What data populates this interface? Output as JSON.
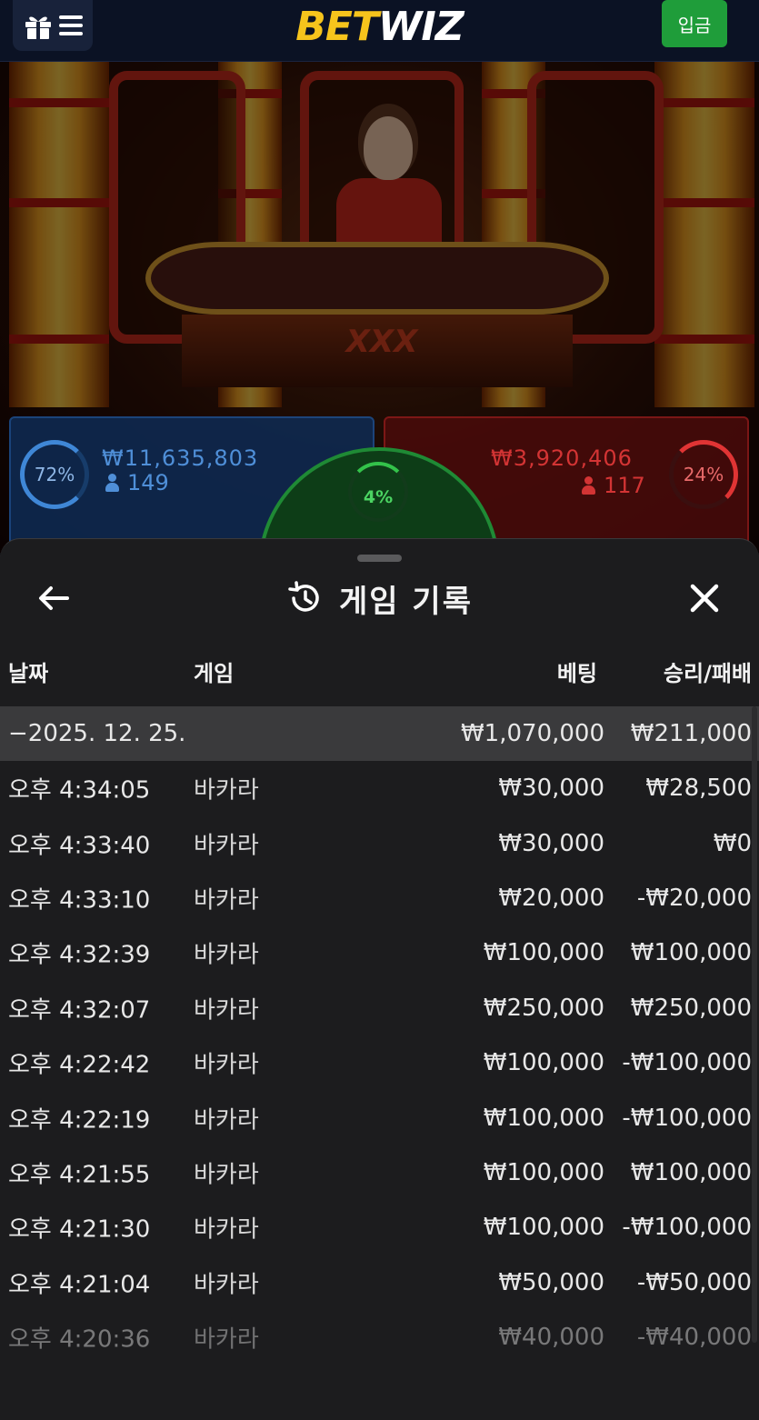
{
  "header": {
    "logo_bet": "BET",
    "logo_wiz": "WIZ",
    "deposit_label": "입금"
  },
  "stream": {
    "table_logo": "XXX",
    "player": {
      "amount": "₩11,635,803",
      "count": "149",
      "percent": "72%",
      "color": "#1d4f8f"
    },
    "banker": {
      "amount": "₩3,920,406",
      "count": "117",
      "percent": "24%",
      "color": "#8e1a1a"
    },
    "tie": {
      "percent": "4%",
      "color": "#1f8a35"
    }
  },
  "history": {
    "title": "게임 기록",
    "columns": {
      "date": "날짜",
      "game": "게임",
      "bet": "베팅",
      "winloss": "승리/패배"
    },
    "group": {
      "date": "−2025. 12. 25.",
      "bet": "₩1,070,000",
      "winloss": "₩211,000"
    },
    "rows": [
      {
        "time": "오후 4:34:05",
        "game": "바카라",
        "bet": "₩30,000",
        "winloss": "₩28,500"
      },
      {
        "time": "오후 4:33:40",
        "game": "바카라",
        "bet": "₩30,000",
        "winloss": "₩0"
      },
      {
        "time": "오후 4:33:10",
        "game": "바카라",
        "bet": "₩20,000",
        "winloss": "-₩20,000"
      },
      {
        "time": "오후 4:32:39",
        "game": "바카라",
        "bet": "₩100,000",
        "winloss": "₩100,000"
      },
      {
        "time": "오후 4:32:07",
        "game": "바카라",
        "bet": "₩250,000",
        "winloss": "₩250,000"
      },
      {
        "time": "오후 4:22:42",
        "game": "바카라",
        "bet": "₩100,000",
        "winloss": "-₩100,000"
      },
      {
        "time": "오후 4:22:19",
        "game": "바카라",
        "bet": "₩100,000",
        "winloss": "-₩100,000"
      },
      {
        "time": "오후 4:21:55",
        "game": "바카라",
        "bet": "₩100,000",
        "winloss": "₩100,000"
      },
      {
        "time": "오후 4:21:30",
        "game": "바카라",
        "bet": "₩100,000",
        "winloss": "-₩100,000"
      },
      {
        "time": "오후 4:21:04",
        "game": "바카라",
        "bet": "₩50,000",
        "winloss": "-₩50,000"
      },
      {
        "time": "오후 4:20:36",
        "game": "바카라",
        "bet": "₩40,000",
        "winloss": "-₩40,000"
      }
    ]
  },
  "icons": {
    "gift": "gift-icon",
    "menu": "hamburger-menu-icon",
    "back": "arrow-left-icon",
    "history": "history-clock-icon",
    "close": "close-x-icon",
    "person": "person-icon"
  },
  "colors": {
    "topbar": "#0b1224",
    "brand_yellow": "#f6c41c",
    "deposit_green": "#1f9d3a",
    "sheet_bg": "#1c1c1e",
    "group_row": "#3a3a3c"
  }
}
